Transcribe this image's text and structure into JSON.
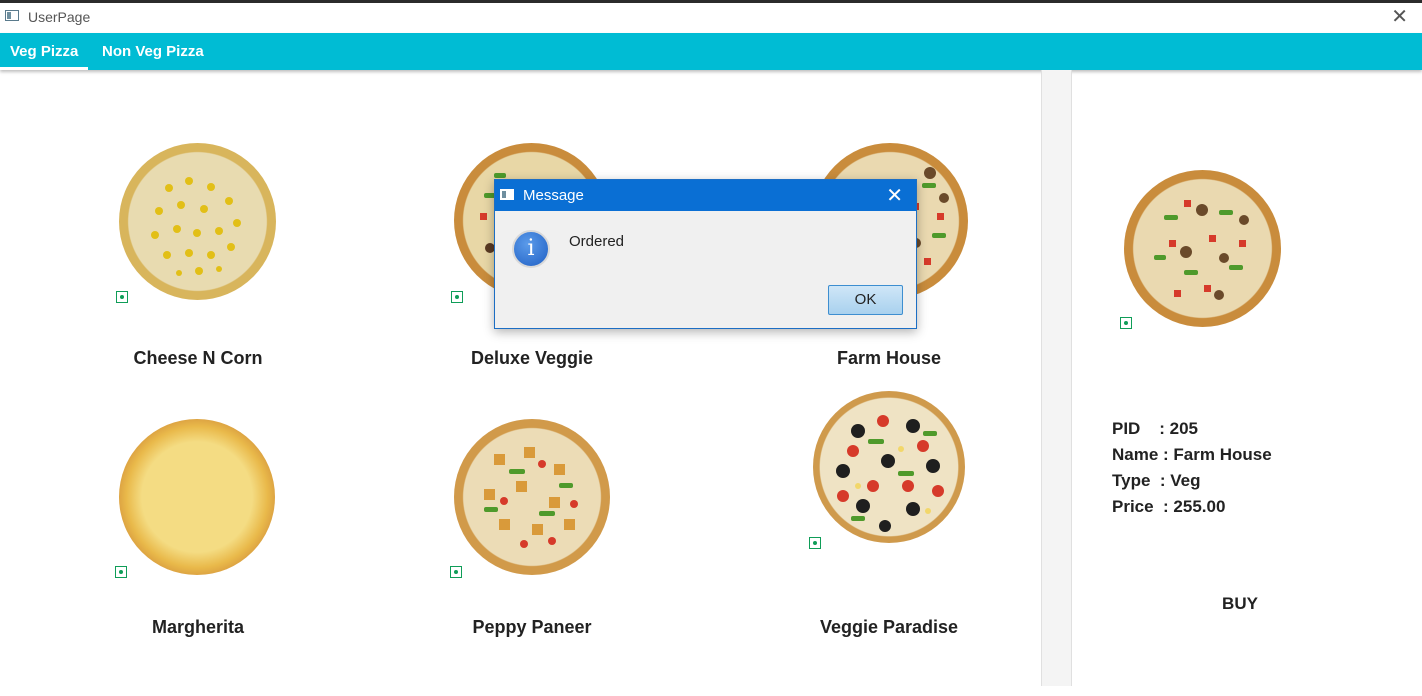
{
  "window": {
    "title": "UserPage",
    "close_glyph": "✕"
  },
  "tabs": [
    {
      "label": "Veg Pizza",
      "active": true
    },
    {
      "label": "Non Veg Pizza",
      "active": false
    }
  ],
  "products": [
    {
      "name": "Cheese N Corn",
      "veg": true
    },
    {
      "name": "Deluxe Veggie",
      "veg": true
    },
    {
      "name": "Farm House",
      "veg": true
    },
    {
      "name": "Margherita",
      "veg": true
    },
    {
      "name": "Peppy Paneer",
      "veg": true
    },
    {
      "name": "Veggie Paradise",
      "veg": true
    }
  ],
  "details": {
    "pid": "PID    : 205",
    "name": "Name : Farm House",
    "type": "Type  : Veg",
    "price": "Price  : 255.00",
    "buy_label": "BUY"
  },
  "dialog": {
    "title": "Message",
    "close_glyph": "✕",
    "icon": "info-icon",
    "icon_glyph": "i",
    "message": "Ordered",
    "ok_label": "OK"
  },
  "colors": {
    "accent": "#00bcd4",
    "dialog_titlebar": "#0a6fd4",
    "veg_mark": "#0f9d58"
  }
}
